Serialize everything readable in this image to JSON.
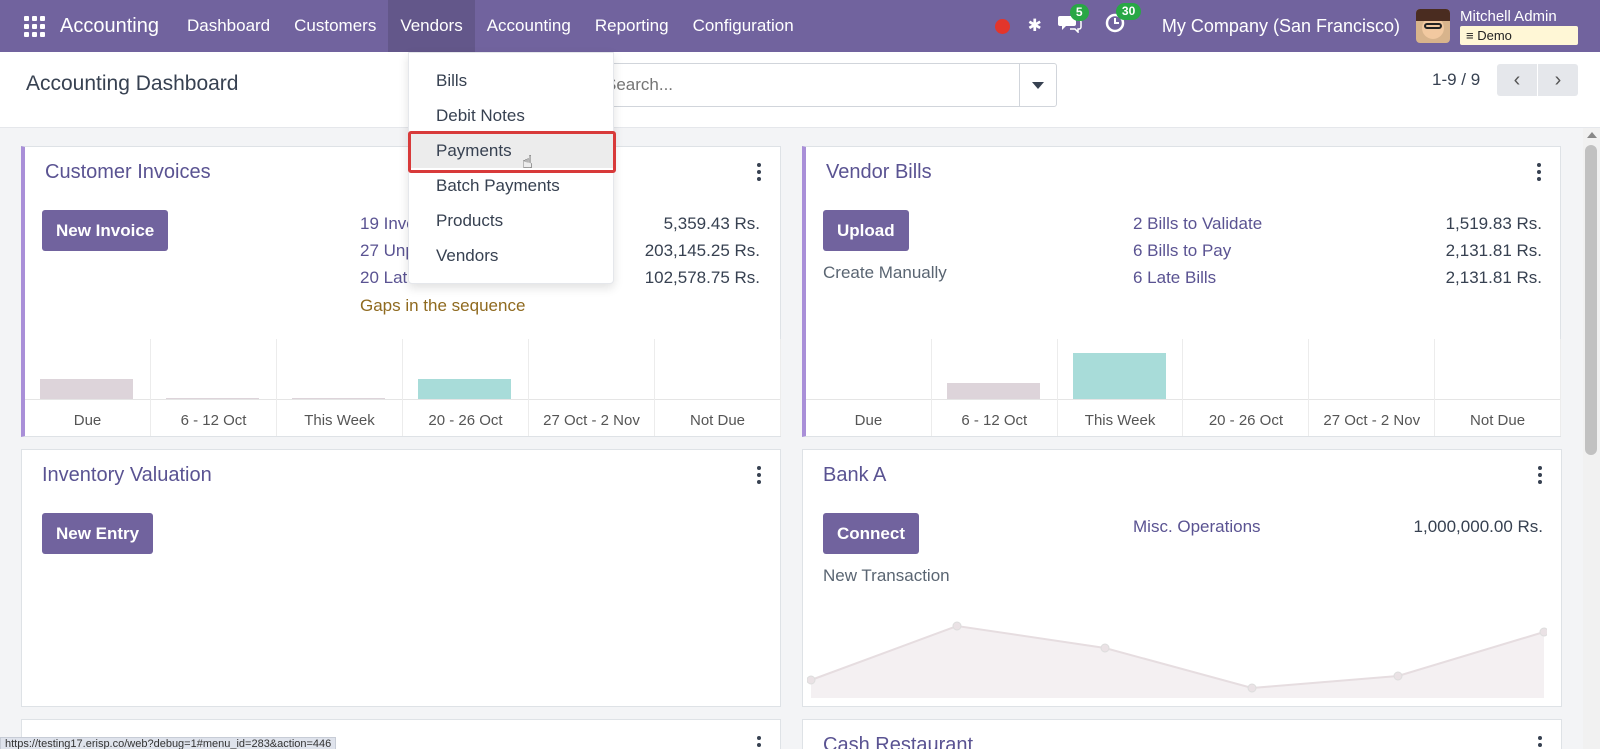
{
  "navbar": {
    "brand": "Accounting",
    "menu": [
      "Dashboard",
      "Customers",
      "Vendors",
      "Accounting",
      "Reporting",
      "Configuration"
    ],
    "active_menu": "Vendors",
    "messages_count": "5",
    "activities_count": "30",
    "company": "My Company (San Francisco)",
    "user_name": "Mitchell Admin",
    "database": "Demo",
    "accent_color": "#71639e"
  },
  "control_panel": {
    "title": "Accounting Dashboard",
    "search_placeholder": "Search...",
    "pager": "1-9 / 9"
  },
  "vendors_menu": {
    "items": [
      "Bills",
      "Debit Notes",
      "Payments",
      "Batch Payments",
      "Products",
      "Vendors"
    ],
    "highlighted": "Payments"
  },
  "customer_invoices": {
    "title": "Customer Invoices",
    "button": "New Invoice",
    "stats": [
      {
        "label": "19 Invoices to Validate",
        "value": "5,359.43 Rs."
      },
      {
        "label": "27 Unpaid Invoices",
        "value": "203,145.25 Rs."
      },
      {
        "label": "20 Late Invoices",
        "value": "102,578.75 Rs."
      }
    ],
    "gaps_link": "Gaps in the sequence",
    "chart_labels": [
      "Due",
      "6 - 12 Oct",
      "This Week",
      "20 - 26 Oct",
      "27 Oct - 2 Nov",
      "Not Due"
    ],
    "chart_bars": [
      0.33,
      0.02,
      0.02,
      0.33,
      0,
      0
    ]
  },
  "vendor_bills": {
    "title": "Vendor Bills",
    "button": "Upload",
    "create_link": "Create Manually",
    "stats": [
      {
        "label": "2 Bills to Validate",
        "value": "1,519.83 Rs."
      },
      {
        "label": "6 Bills to Pay",
        "value": "2,131.81 Rs."
      },
      {
        "label": "6 Late Bills",
        "value": "2,131.81 Rs."
      }
    ],
    "chart_labels": [
      "Due",
      "6 - 12 Oct",
      "This Week",
      "20 - 26 Oct",
      "27 Oct - 2 Nov",
      "Not Due"
    ],
    "chart_bars": [
      0,
      0.27,
      0.77,
      0,
      0,
      0
    ]
  },
  "inventory_valuation": {
    "title": "Inventory Valuation",
    "button": "New Entry"
  },
  "bank_a": {
    "title": "Bank A",
    "button": "Connect",
    "new_transaction": "New Transaction",
    "misc_label": "Misc. Operations",
    "misc_value": "1,000,000.00 Rs."
  },
  "cash_restaurant": {
    "title": "Cash Restaurant"
  },
  "status_url": "https://testing17.erisp.co/web?debug=1#menu_id=283&action=446"
}
